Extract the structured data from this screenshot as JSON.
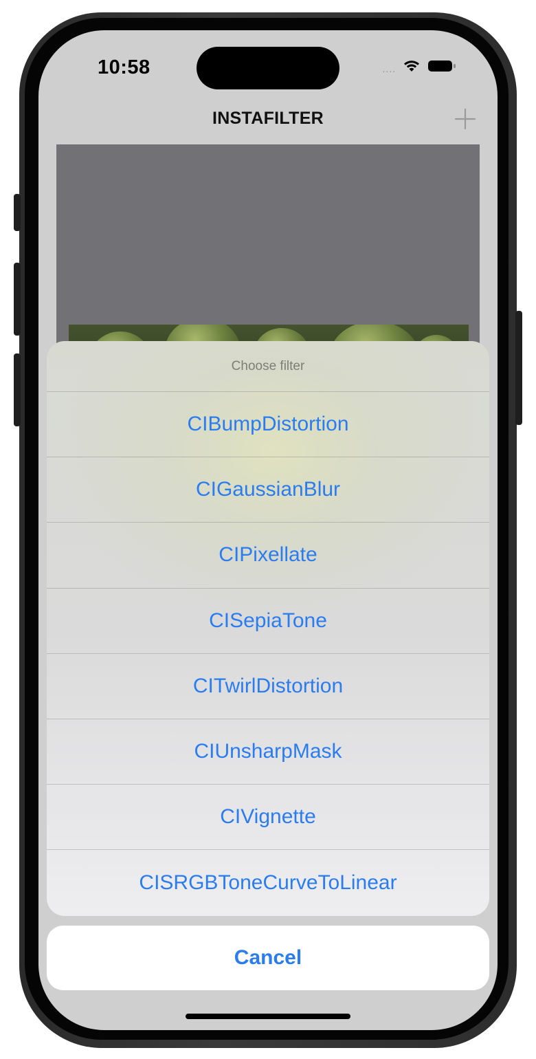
{
  "status_bar": {
    "time": "10:58",
    "signal_indicator": "....",
    "wifi_icon": "wifi-icon",
    "battery_icon": "battery-icon"
  },
  "nav": {
    "title": "INSTAFILTER",
    "add_icon": "plus-icon"
  },
  "sheet": {
    "title": "Choose filter",
    "options": [
      "CIBumpDistortion",
      "CIGaussianBlur",
      "CIPixellate",
      "CISepiaTone",
      "CITwirlDistortion",
      "CIUnsharpMask",
      "CIVignette",
      "CISRGBToneCurveToLinear"
    ],
    "cancel_label": "Cancel"
  },
  "colors": {
    "accent": "#2a7cef",
    "image_placeholder": "#727176",
    "screen_background": "#cfcfcf"
  }
}
